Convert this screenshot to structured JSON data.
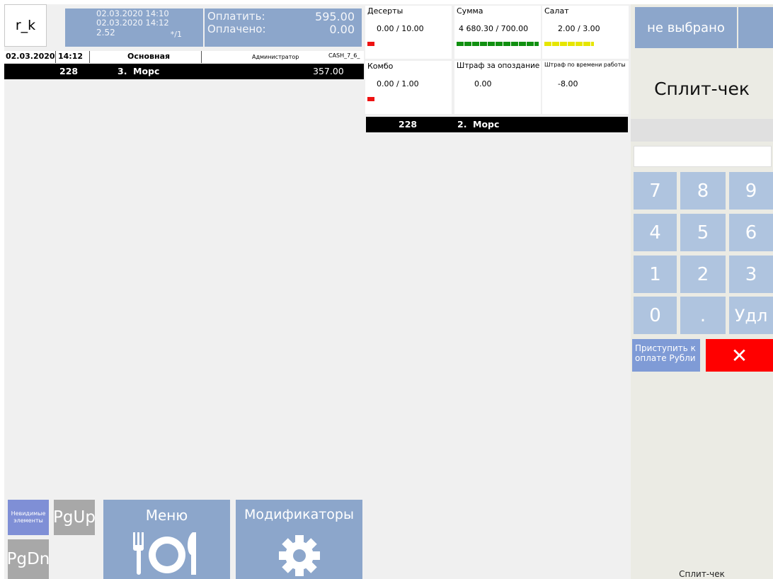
{
  "header": {
    "brand": "r_k",
    "opened_time": "02.03.2020 14:10",
    "current_time": "02.03.2020 14:12",
    "elapsed": "2.52",
    "guests": "*/1",
    "to_pay_label": "Оплатить:",
    "to_pay_value": "595.00",
    "paid_label": "Оплачено:",
    "paid_value": "0.00"
  },
  "order_info": {
    "date": "02.03.2020",
    "time": "14:12",
    "menu": "Основная",
    "waiter": "Администратор",
    "station": "CASH_7_6_"
  },
  "left_items": [
    {
      "code": "228",
      "index": "3.",
      "name": "Морс",
      "price": "357.00"
    }
  ],
  "promos": [
    {
      "title": "Десерты",
      "value": "0.00 / 10.00",
      "bar_color": "#ee1111",
      "bar_fill": 0.1
    },
    {
      "title": "Сумма",
      "value": "4 680.30 / 700.00",
      "bar_color": "#109010",
      "bar_fill": 1.0
    },
    {
      "title": "Салат",
      "value": "2.00 / 3.00",
      "bar_color": "#e6e600",
      "bar_fill": 0.67
    },
    {
      "title": "Комбо",
      "value": "0.00 / 1.00",
      "bar_color": "#ee1111",
      "bar_fill": 0.1
    },
    {
      "title": "Штраф за опоздание",
      "value": "0.00",
      "bar_color": "",
      "bar_fill": 0
    },
    {
      "title": "Штраф по времени работы",
      "value": "-8.00",
      "bar_color": "",
      "bar_fill": 0
    }
  ],
  "split_items": [
    {
      "code": "228",
      "index": "2.",
      "name": "Морс"
    }
  ],
  "bottom_buttons": {
    "invisible": "Невидимые элементы",
    "pgup": "PgUp",
    "pgdn": "PgDn",
    "menu": "Меню",
    "modifiers": "Модификаторы"
  },
  "right_panel": {
    "not_selected": "не выбрано",
    "title": "Сплит-чек",
    "input_value": "",
    "keys": [
      "7",
      "8",
      "9",
      "4",
      "5",
      "6",
      "1",
      "2",
      "3",
      "0",
      ".",
      "Удл"
    ],
    "pay_rub": "Приступить к оплате Рубли",
    "close": "✕",
    "footer": "Сплит-чек"
  },
  "icons": {
    "menu": "plate-cutlery-icon",
    "modifiers": "gear-icon",
    "close": "close-icon"
  }
}
